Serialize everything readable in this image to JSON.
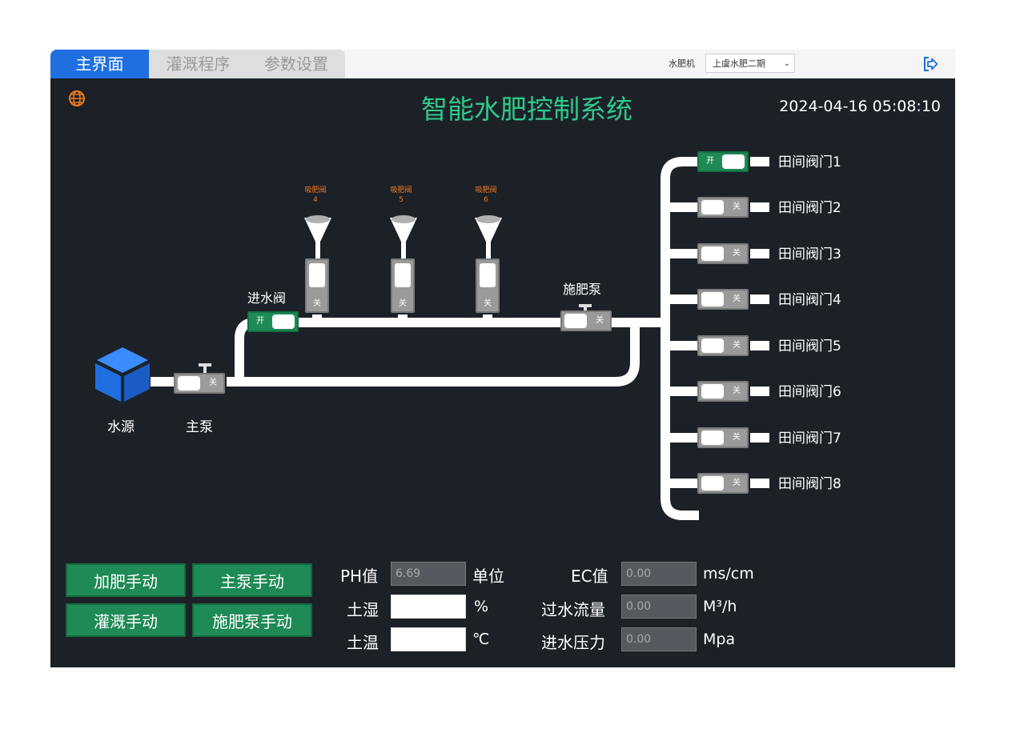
{
  "tabs": [
    {
      "label": "主界面",
      "active": true
    },
    {
      "label": "灌溉程序",
      "active": false
    },
    {
      "label": "参数设置",
      "active": false
    }
  ],
  "machine": {
    "label": "水肥机",
    "selected": "上虞水肥二期"
  },
  "header": {
    "title": "智能水肥控制系统",
    "datetime": "2024-04-16 05:08:10"
  },
  "diagram": {
    "water_source": "水源",
    "main_pump": {
      "label": "主泵",
      "state": "关"
    },
    "inlet_valve": {
      "label": "进水阀",
      "state": "开"
    },
    "fert_pump": {
      "label": "施肥泵",
      "state": "关"
    },
    "suction_valves": [
      {
        "label": "吸肥阀",
        "num": "4",
        "state": "关"
      },
      {
        "label": "吸肥阀",
        "num": "5",
        "state": "关"
      },
      {
        "label": "吸肥阀",
        "num": "6",
        "state": "关"
      }
    ],
    "field_valves": [
      {
        "label": "田间阀门1",
        "state": "开"
      },
      {
        "label": "田间阀门2",
        "state": "关"
      },
      {
        "label": "田间阀门3",
        "state": "关"
      },
      {
        "label": "田间阀门4",
        "state": "关"
      },
      {
        "label": "田间阀门5",
        "state": "关"
      },
      {
        "label": "田间阀门6",
        "state": "关"
      },
      {
        "label": "田间阀门7",
        "state": "关"
      },
      {
        "label": "田间阀门8",
        "state": "关"
      }
    ]
  },
  "buttons": {
    "fert_manual": "加肥手动",
    "main_pump_manual": "主泵手动",
    "irrigation_manual": "灌溉手动",
    "fert_pump_manual": "施肥泵手动"
  },
  "readings": {
    "ph": {
      "label": "PH值",
      "value": "6.69",
      "unit": "单位"
    },
    "soil_moisture": {
      "label": "土湿",
      "value": "",
      "unit": "%"
    },
    "soil_temp": {
      "label": "土温",
      "value": "",
      "unit": "℃"
    },
    "ec": {
      "label": "EC值",
      "value": "0.00",
      "unit": "ms/cm"
    },
    "flow": {
      "label": "过水流量",
      "value": "0.00",
      "unit": "M³/h"
    },
    "pressure": {
      "label": "进水压力",
      "value": "0.00",
      "unit": "Mpa"
    }
  },
  "colors": {
    "accent": "#1f6fe0",
    "title": "#2fc98a",
    "on": "#1e8a55",
    "off": "#9a9a9a",
    "panel": "#1c2128",
    "orange": "#f07b1a"
  }
}
